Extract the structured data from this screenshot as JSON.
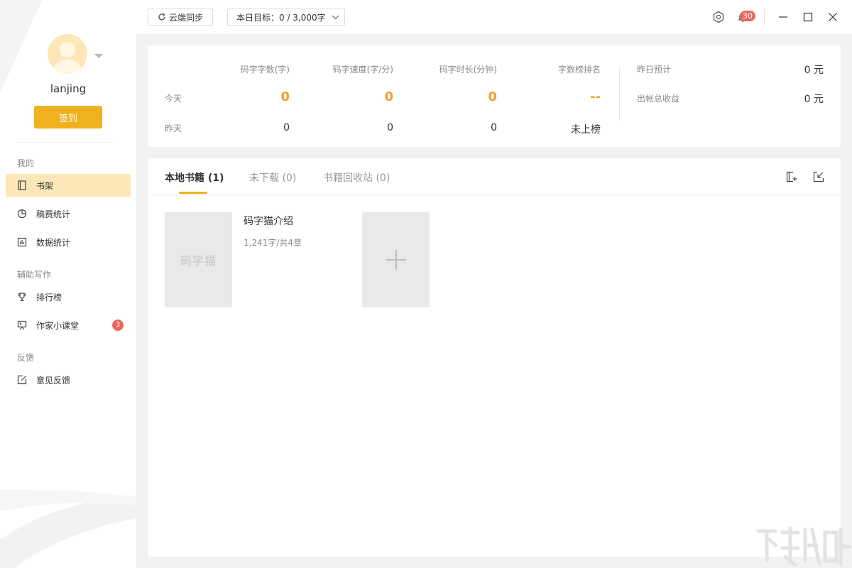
{
  "sidebar": {
    "username": "lanjing",
    "checkin_label": "签到",
    "sections": {
      "mine": "我的",
      "assist": "辅助写作",
      "feedback": "反馈"
    },
    "items": [
      {
        "label": "书架",
        "icon": "bookshelf-icon",
        "active": true
      },
      {
        "label": "稿费统计",
        "icon": "pie-chart-icon"
      },
      {
        "label": "数据统计",
        "icon": "bar-chart-icon"
      },
      {
        "label": "排行榜",
        "icon": "trophy-icon"
      },
      {
        "label": "作家小课堂",
        "icon": "classroom-icon",
        "badge": "3"
      },
      {
        "label": "意见反馈",
        "icon": "edit-icon"
      }
    ]
  },
  "topbar": {
    "sync_label": "云端同步",
    "goal_label": "本日目标：0 / 3,000字",
    "notification_count": "30"
  },
  "stats": {
    "headers": [
      "码字字数(字)",
      "码字速度(字/分)",
      "码字时长(分钟)",
      "字数榜排名"
    ],
    "today_label": "今天",
    "yesterday_label": "昨天",
    "today": [
      "0",
      "0",
      "0",
      "--"
    ],
    "yesterday": [
      "0",
      "0",
      "0",
      "未上榜"
    ],
    "earnings": {
      "yesterday_estimate_label": "昨日预计",
      "yesterday_estimate_value": "0 元",
      "total_label": "出帐总收益",
      "total_value": "0 元"
    }
  },
  "books": {
    "tabs": [
      "本地书籍 (1)",
      "未下载 (0)",
      "书籍回收站 (0)"
    ],
    "list": [
      {
        "title": "码字猫介绍",
        "meta": "1,241字/共4章",
        "cover_logo": "码字猫"
      }
    ]
  },
  "colors": {
    "accent": "#f0b11e",
    "highlight_value": "#f0a030",
    "active_item_bg": "#fde6b8",
    "badge": "#e8685f"
  }
}
